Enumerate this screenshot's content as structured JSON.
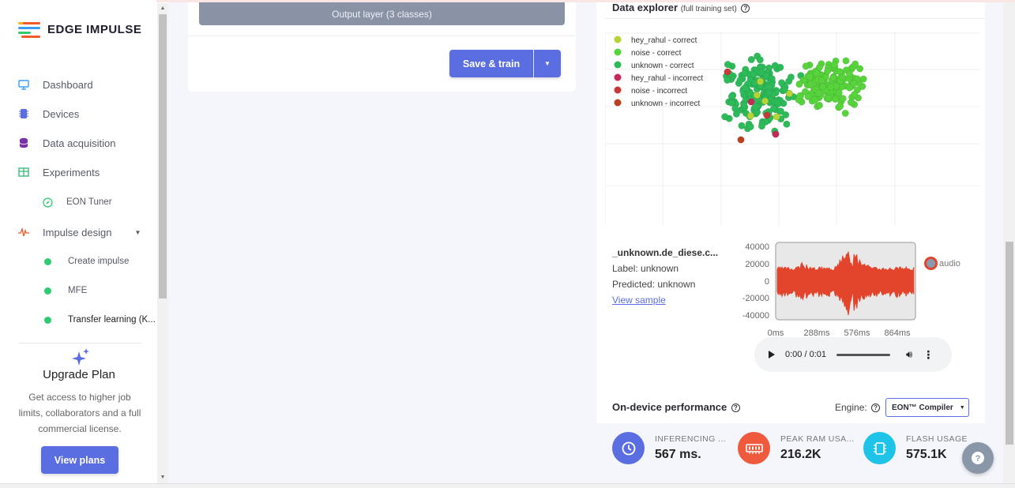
{
  "brand": {
    "name": "EDGE IMPULSE",
    "colors": [
      "#f05a28",
      "#f7b22c",
      "#2ecc71",
      "#3a9ef5"
    ]
  },
  "sidebar": {
    "items": [
      {
        "label": "Dashboard",
        "icon": "monitor-icon"
      },
      {
        "label": "Devices",
        "icon": "chip-icon"
      },
      {
        "label": "Data acquisition",
        "icon": "database-icon"
      },
      {
        "label": "Experiments",
        "icon": "table-icon"
      }
    ],
    "eon_tuner": {
      "label": "EON Tuner",
      "icon": "compass-icon"
    },
    "impulse_design": {
      "label": "Impulse design",
      "icon": "pulse-icon"
    },
    "sub_items": [
      {
        "label": "Create impulse"
      },
      {
        "label": "MFE"
      },
      {
        "label": "Transfer learning (K..."
      }
    ],
    "upgrade": {
      "title": "Upgrade Plan",
      "text": "Get access to higher job limits, collaborators and a full commercial license.",
      "button": "View plans"
    }
  },
  "training": {
    "output_layer": "Output layer (3 classes)",
    "save_train": "Save & train"
  },
  "data_explorer": {
    "title": "Data explorer",
    "subtitle": "(full training set)",
    "legend": [
      {
        "label": "hey_rahul - correct",
        "color": "#b5d334"
      },
      {
        "label": "noise - correct",
        "color": "#57d43c"
      },
      {
        "label": "unknown - correct",
        "color": "#2dbb5a"
      },
      {
        "label": "hey_rahul - incorrect",
        "color": "#c42a57"
      },
      {
        "label": "noise - incorrect",
        "color": "#c73a3a"
      },
      {
        "label": "unknown - incorrect",
        "color": "#b8421f"
      }
    ]
  },
  "sample": {
    "name": "_unknown.de_diese.c...",
    "label": "Label: unknown",
    "predicted": "Predicted: unknown",
    "view": "View sample",
    "y_ticks": [
      "40000",
      "20000",
      "0",
      "-20000",
      "-40000"
    ],
    "x_ticks": [
      "0ms",
      "288ms",
      "576ms",
      "864ms"
    ],
    "legend": "audio",
    "wave_color": "#e2452b"
  },
  "player": {
    "time": "0:00 / 0:01"
  },
  "performance": {
    "title": "On-device performance",
    "engine_label": "Engine:",
    "engine": "EON™ Compiler",
    "metrics": [
      {
        "label": "INFERENCING ...",
        "value": "567 ms.",
        "color": "#5b6ee1",
        "icon": "clock-icon"
      },
      {
        "label": "PEAK RAM USA...",
        "value": "216.2K",
        "color": "#f05a3c",
        "icon": "ram-icon"
      },
      {
        "label": "FLASH USAGE",
        "value": "575.1K",
        "color": "#1ec3e8",
        "icon": "flash-chip-icon"
      }
    ]
  },
  "help": {
    "icon": "question-icon"
  }
}
